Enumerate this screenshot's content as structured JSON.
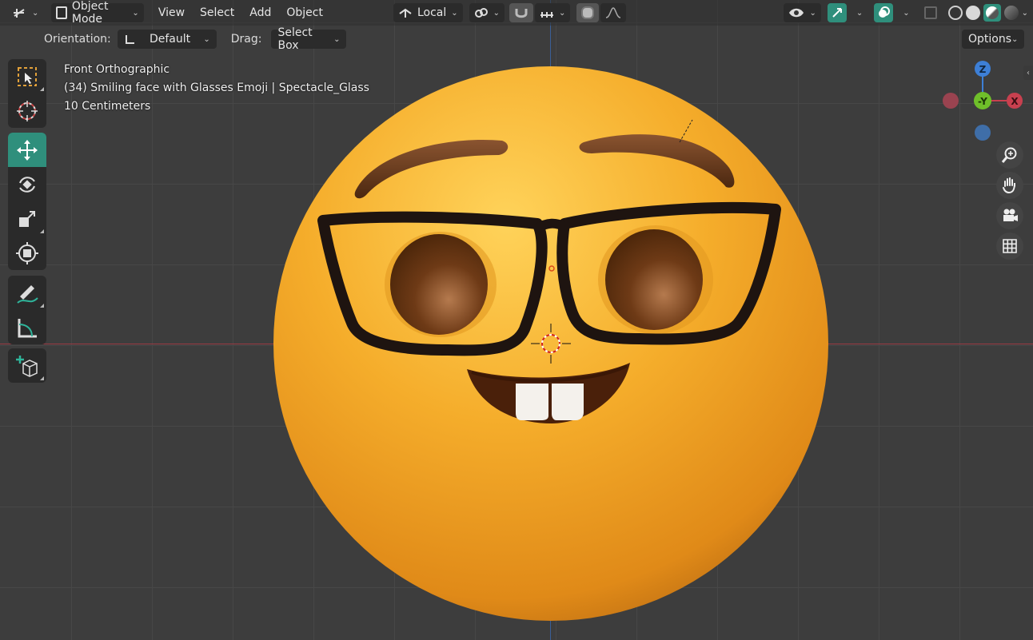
{
  "header": {
    "mode_label": "Object Mode",
    "menu": [
      "View",
      "Select",
      "Add",
      "Object"
    ],
    "transform_orientation": "Local"
  },
  "subheader": {
    "orientation_label": "Orientation:",
    "orientation_value": "Default",
    "drag_label": "Drag:",
    "drag_value": "Select Box",
    "options_label": "Options"
  },
  "overlay": {
    "view_name": "Front Orthographic",
    "object_info": "(34) Smiling face with Glasses Emoji | Spectacle_Glass",
    "scale": "10 Centimeters"
  },
  "gizmo": {
    "z_label": "Z",
    "y_label": "-Y",
    "x_label": "X"
  },
  "toolbar": {
    "tools": [
      "select-box",
      "cursor",
      "move",
      "rotate",
      "scale",
      "transform",
      "annotate",
      "measure",
      "add-cube"
    ],
    "active_tool": "move"
  },
  "colors": {
    "accent": "#2f8f7c",
    "x_axis": "#c8404f",
    "y_axis": "#6fbf2a",
    "z_axis": "#3d7fd6",
    "emoji_face": "#f2a827"
  }
}
